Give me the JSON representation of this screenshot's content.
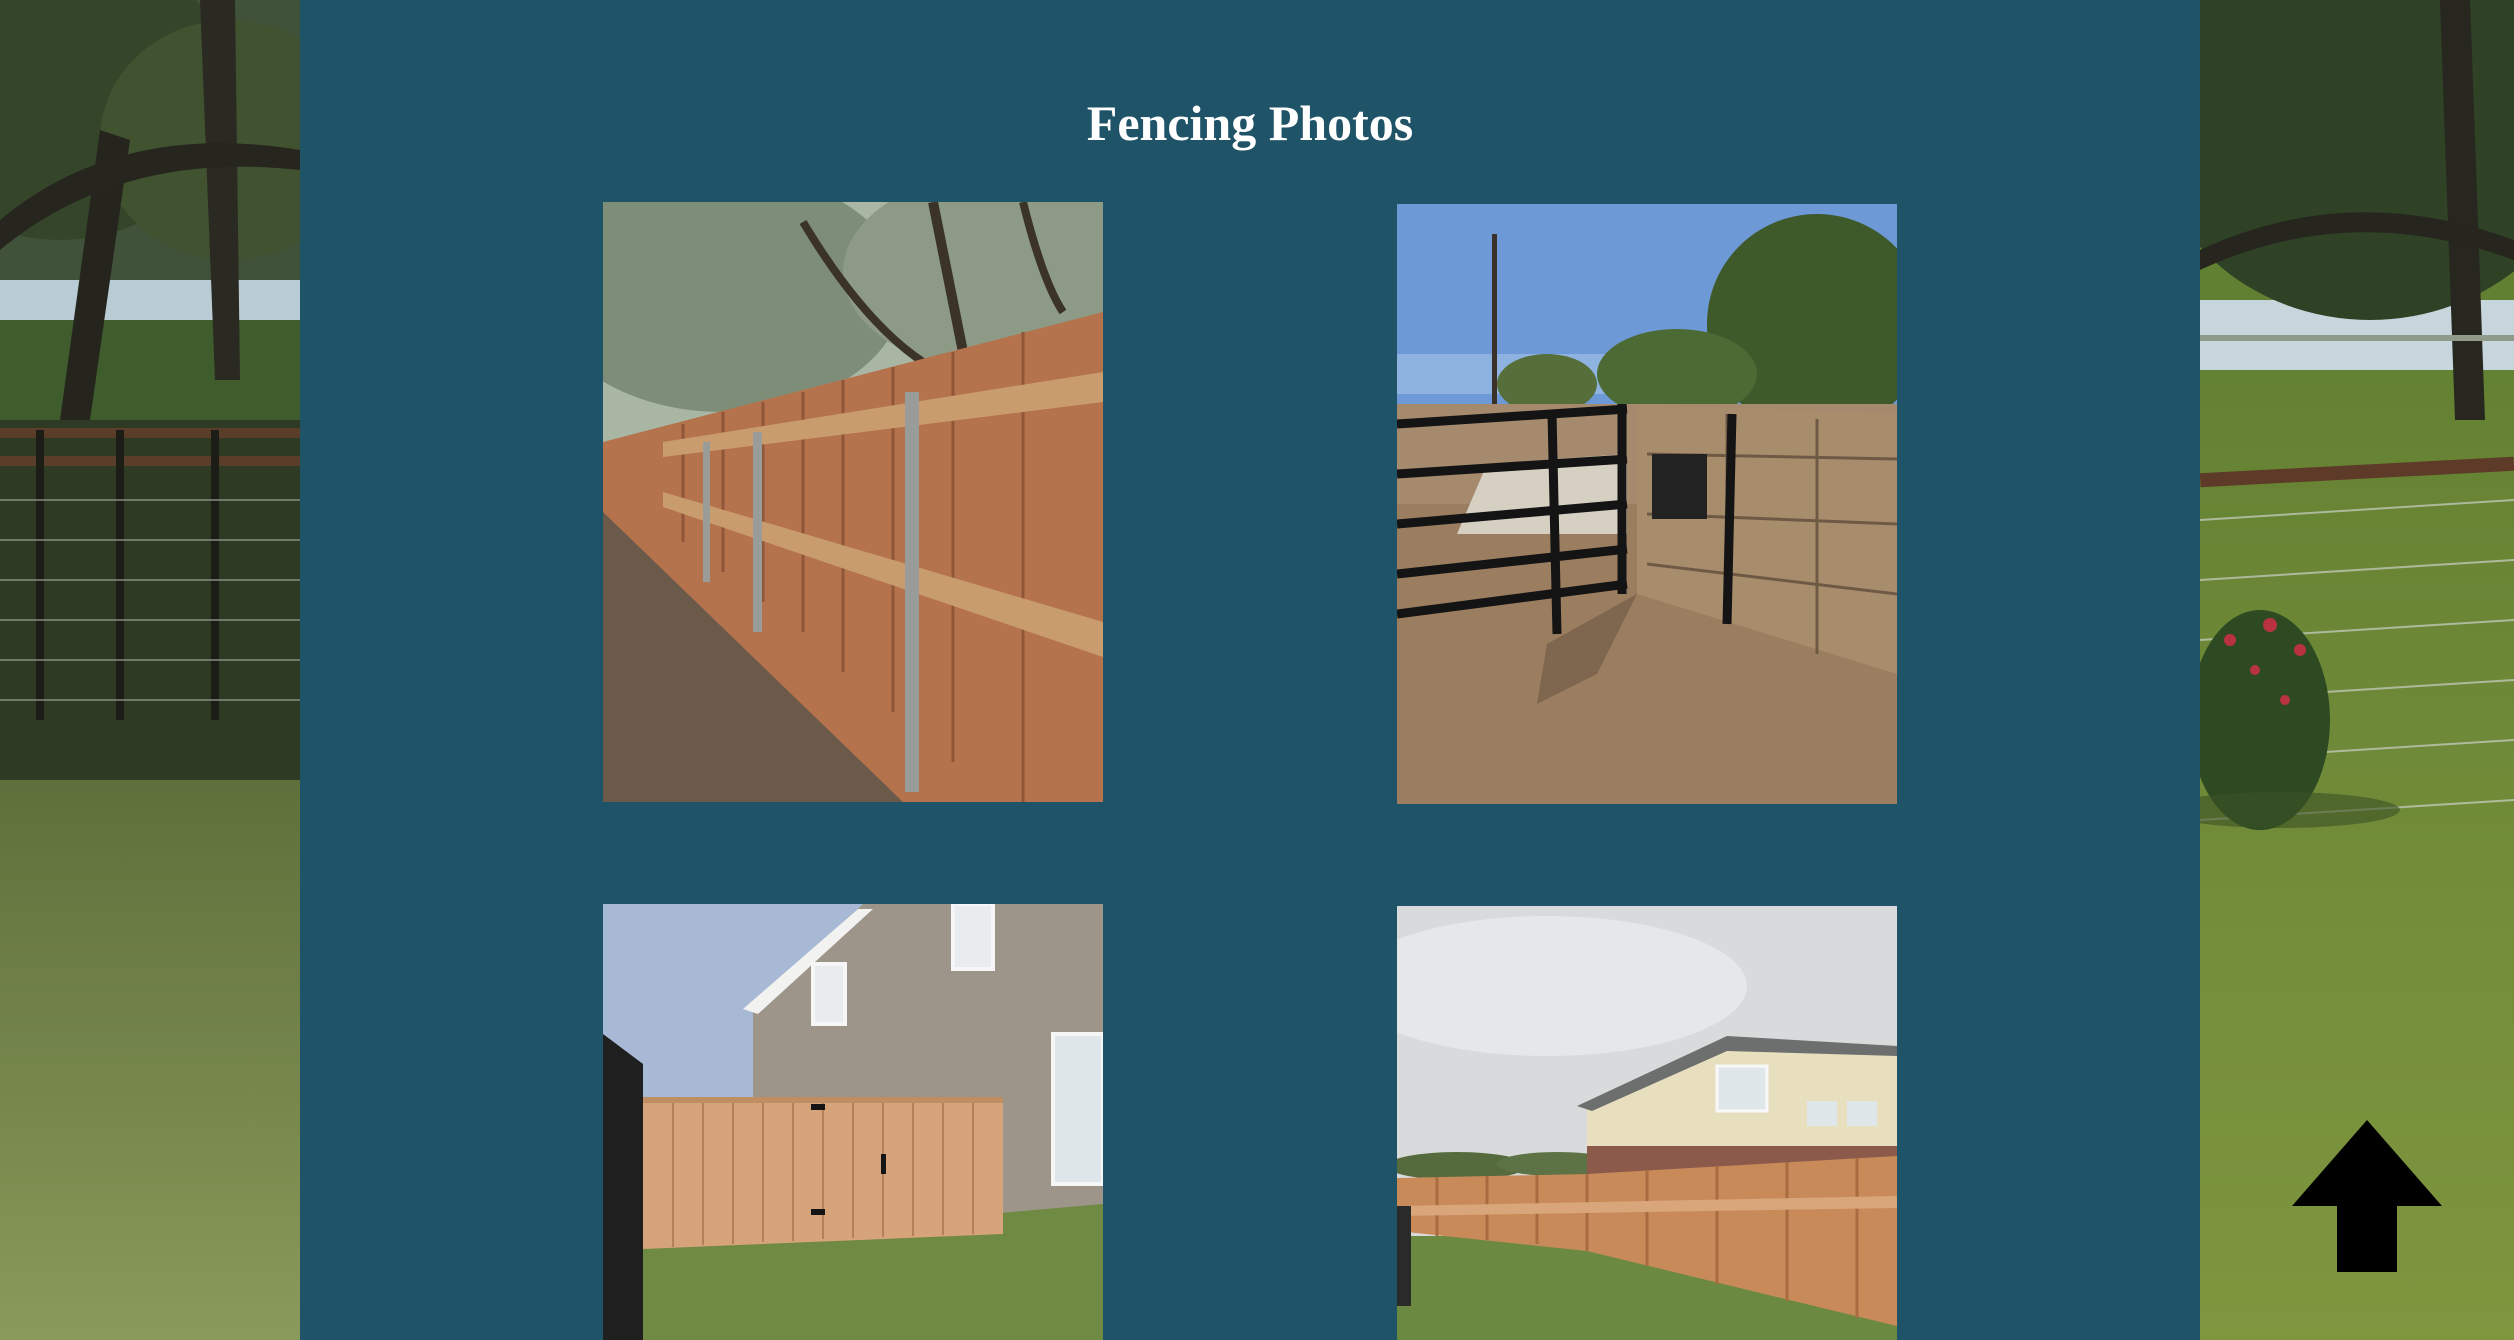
{
  "page": {
    "title": "Fencing Photos"
  },
  "photos": [
    {
      "subject": "wood-privacy-fence-with-steel-posts"
    },
    {
      "subject": "black-metal-gate-beside-stone-pillar"
    },
    {
      "subject": "cedar-backyard-fence-with-gate"
    },
    {
      "subject": "cedar-fence-along-new-house"
    }
  ],
  "controls": {
    "back_to_top_icon": "arrow-up-icon"
  },
  "colors": {
    "panel_background": "#1f5367",
    "title_text": "#ffffff",
    "arrow": "#000000"
  }
}
